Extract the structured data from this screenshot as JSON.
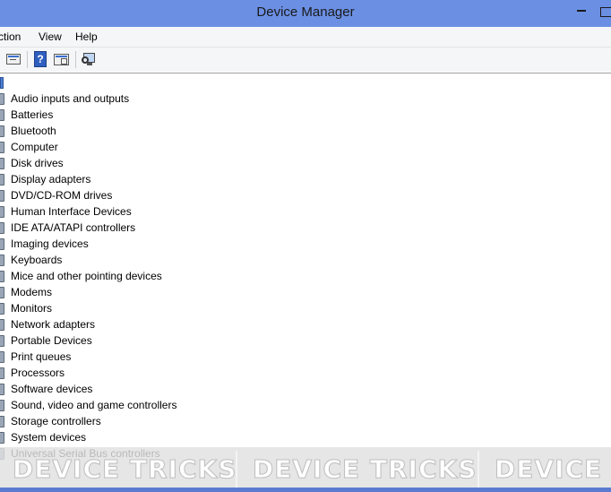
{
  "window": {
    "title": "Device Manager",
    "accent_color": "#6b8fe3"
  },
  "menu": {
    "action": "ction",
    "view": "View",
    "help": "Help"
  },
  "toolbar": {
    "icons": [
      "properties-icon",
      "help-icon",
      "show-hide-console-tree-icon",
      "scan-hardware-changes-icon"
    ]
  },
  "tree": {
    "items": [
      {
        "label": "Audio inputs and outputs",
        "icon": "speaker-icon"
      },
      {
        "label": "Batteries",
        "icon": "battery-icon"
      },
      {
        "label": "Bluetooth",
        "icon": "bluetooth-icon"
      },
      {
        "label": "Computer",
        "icon": "computer-icon"
      },
      {
        "label": "Disk drives",
        "icon": "disk-drive-icon"
      },
      {
        "label": "Display adapters",
        "icon": "display-adapter-icon"
      },
      {
        "label": "DVD/CD-ROM drives",
        "icon": "optical-drive-icon"
      },
      {
        "label": "Human Interface Devices",
        "icon": "hid-icon"
      },
      {
        "label": "IDE ATA/ATAPI controllers",
        "icon": "ide-controller-icon"
      },
      {
        "label": "Imaging devices",
        "icon": "camera-icon"
      },
      {
        "label": "Keyboards",
        "icon": "keyboard-icon"
      },
      {
        "label": "Mice and other pointing devices",
        "icon": "mouse-icon"
      },
      {
        "label": "Modems",
        "icon": "modem-icon"
      },
      {
        "label": "Monitors",
        "icon": "monitor-icon"
      },
      {
        "label": "Network adapters",
        "icon": "network-adapter-icon"
      },
      {
        "label": "Portable Devices",
        "icon": "portable-device-icon"
      },
      {
        "label": "Print queues",
        "icon": "printer-icon"
      },
      {
        "label": "Processors",
        "icon": "processor-icon"
      },
      {
        "label": "Software devices",
        "icon": "software-device-icon"
      },
      {
        "label": "Sound, video and game controllers",
        "icon": "sound-controller-icon"
      },
      {
        "label": "Storage controllers",
        "icon": "storage-controller-icon"
      },
      {
        "label": "System devices",
        "icon": "system-device-icon"
      },
      {
        "label": "Universal Serial Bus controllers",
        "icon": "usb-icon"
      }
    ]
  },
  "watermark": {
    "text": "DEVICE TRICKS",
    "text_cut": "DEVICE T"
  }
}
